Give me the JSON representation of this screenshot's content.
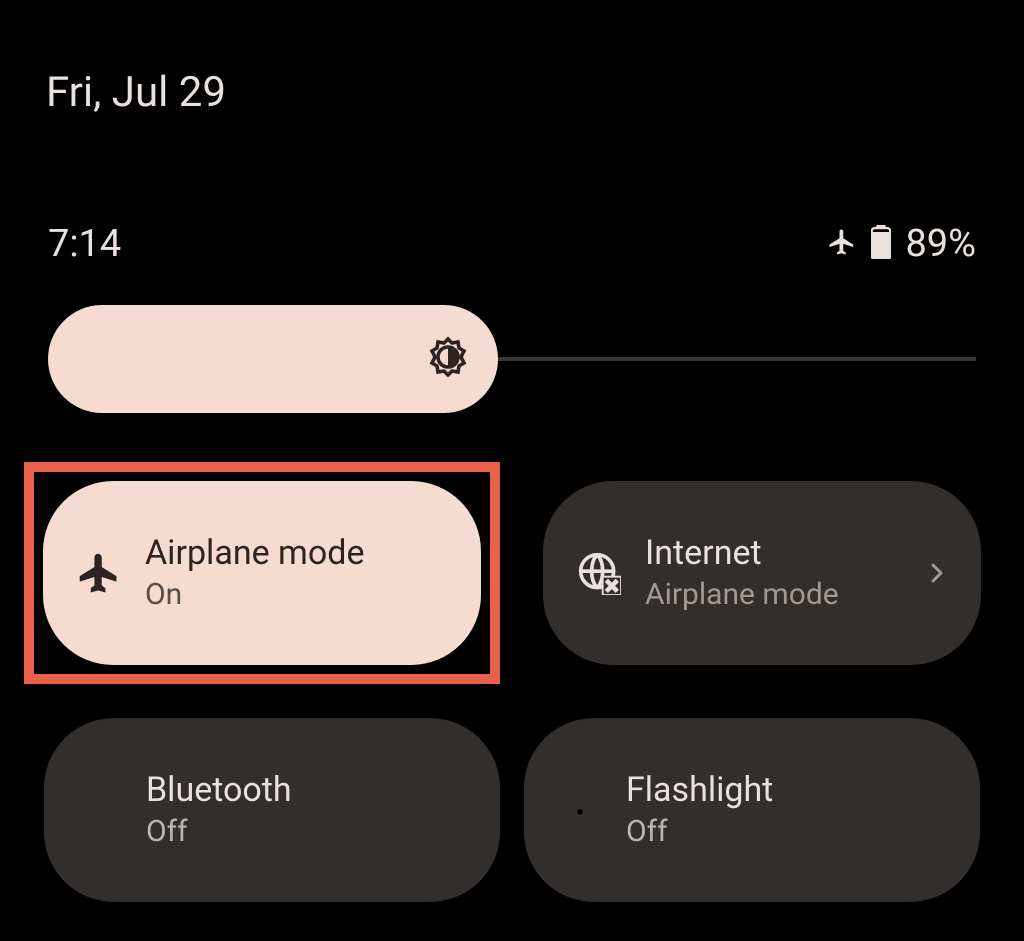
{
  "date": "Fri, Jul 29",
  "time": "7:14",
  "battery": {
    "percent": "89%"
  },
  "brightness": {
    "level": 48
  },
  "tiles": [
    {
      "title": "Airplane mode",
      "subtitle": "On",
      "icon": "airplane",
      "active": true,
      "highlighted": true
    },
    {
      "title": "Internet",
      "subtitle": "Airplane mode",
      "icon": "globe-x",
      "active": false,
      "hasChevron": true
    },
    {
      "title": "Bluetooth",
      "subtitle": "Off",
      "icon": "bluetooth",
      "active": false
    },
    {
      "title": "Flashlight",
      "subtitle": "Off",
      "icon": "flashlight",
      "active": false
    }
  ],
  "colors": {
    "accent": "#f6dbd1",
    "highlight": "#e8624b",
    "tileInactive": "#322e2c",
    "background": "#000000",
    "text": "#e8e1de"
  }
}
